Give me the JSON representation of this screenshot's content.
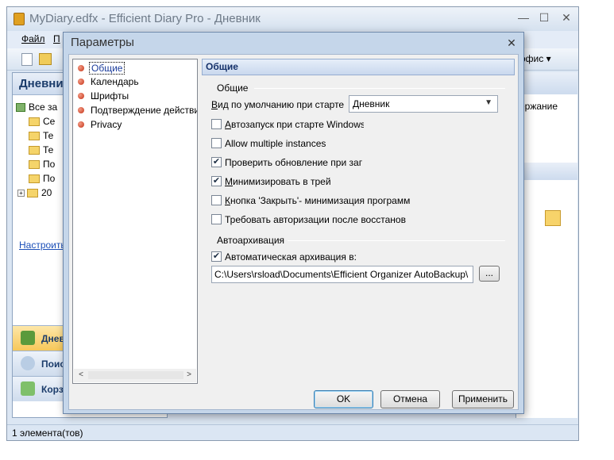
{
  "main_window": {
    "title": "MyDiary.edfx - Efficient Diary Pro - Дневник",
    "minimize_glyph": "—",
    "maximize_glyph": "☐",
    "close_glyph": "✕",
    "menu": [
      "Файл",
      "П"
    ],
    "toolbar_right_label": "офис ▾",
    "left_pane_header": "Дневни",
    "tree": [
      {
        "label": "Все за",
        "icon": "all-entries-icon"
      },
      {
        "label": "Се",
        "icon": "folder-icon"
      },
      {
        "label": "Те",
        "icon": "folder-icon"
      },
      {
        "label": "Те",
        "icon": "folder-icon"
      },
      {
        "label": "По",
        "icon": "folder-icon"
      },
      {
        "label": "По",
        "icon": "folder-icon"
      },
      {
        "label": "20",
        "icon": "folder-icon"
      }
    ],
    "configure_link": "Настроить",
    "nav_buttons": [
      {
        "label": "Днев",
        "icon": "diary-icon",
        "color": "#f2c94c"
      },
      {
        "label": "Поис",
        "icon": "search-icon",
        "color": "#c9d6e6"
      },
      {
        "label": "Корз",
        "icon": "recycle-bin-icon",
        "color": "#8ec56b"
      }
    ],
    "right_column_header": "ержание",
    "status_text": "1 элемента(тов)"
  },
  "dialog": {
    "title": "Параметры",
    "close_glyph": "✕",
    "categories": [
      {
        "label": "Общие",
        "selected": true
      },
      {
        "label": "Календарь",
        "selected": false
      },
      {
        "label": "Шрифты",
        "selected": false
      },
      {
        "label": "Подтверждение действи",
        "selected": false
      },
      {
        "label": "Privacy",
        "selected": false
      }
    ],
    "scroll_left_glyph": "<",
    "scroll_right_glyph": ">",
    "section_header": "Общие",
    "general_group_label": "Общие",
    "default_view_label_underlined": "В",
    "default_view_label_rest": "ид по умолчанию при старте",
    "default_view_value": "Дневник",
    "checkboxes": [
      {
        "underlined": "А",
        "rest": "втозапуск при старте Windows",
        "checked": false
      },
      {
        "underlined": "",
        "rest": "Allow multiple instances",
        "checked": false
      },
      {
        "underlined": "",
        "rest": "Проверить обновление при заг",
        "checked": true
      },
      {
        "underlined": "М",
        "rest": "инимизировать в трей",
        "checked": true
      },
      {
        "underlined": "К",
        "rest": "нопка 'Закрыть'- минимизация программ",
        "checked": false
      },
      {
        "underlined": "",
        "rest": "Требовать авторизации после восстанов",
        "checked": false
      }
    ],
    "autoarchive_group_label": "Автоархивация",
    "autoarchive_checkbox": {
      "label": "Автоматическая архивация в:",
      "checked": true
    },
    "autoarchive_path": "C:\\Users\\rsload\\Documents\\Efficient Organizer AutoBackup\\",
    "browse_button": "...",
    "ok_button": "OK",
    "cancel_button": "Отмена",
    "apply_button": "Применить",
    "check_glyph": "✔"
  }
}
